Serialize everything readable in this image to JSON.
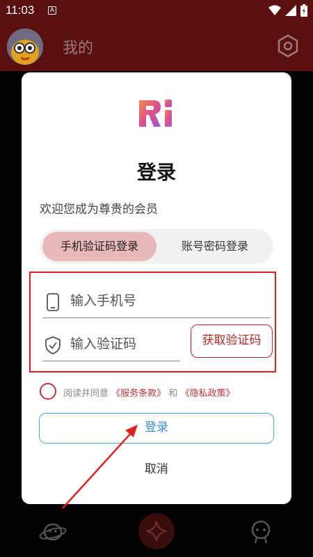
{
  "status_bar": {
    "time": "11:03",
    "notification_glyph": "A"
  },
  "header": {
    "title": "我的",
    "settings_icon": "hexagon-settings-icon"
  },
  "dialog": {
    "logo_text": "Ri",
    "title": "登录",
    "welcome": "欢迎您成为尊贵的会员",
    "tabs": [
      {
        "label": "手机验证码登录",
        "active": true
      },
      {
        "label": "账号密码登录",
        "active": false
      }
    ],
    "phone_placeholder": "输入手机号",
    "code_placeholder": "输入验证码",
    "get_code_label": "获取验证码",
    "agree_prefix": "阅读并同意",
    "terms_link": "《服务条款》",
    "agree_and": "和",
    "privacy_link": "《隐私政策》",
    "login_label": "登录",
    "cancel_label": "取消"
  },
  "colors": {
    "header_bg": "#5a0f10",
    "active_tab": "#e9b8b8",
    "accent_red": "#b02a2a",
    "login_blue": "#3a8fd0",
    "annotation_red": "#e02020"
  }
}
